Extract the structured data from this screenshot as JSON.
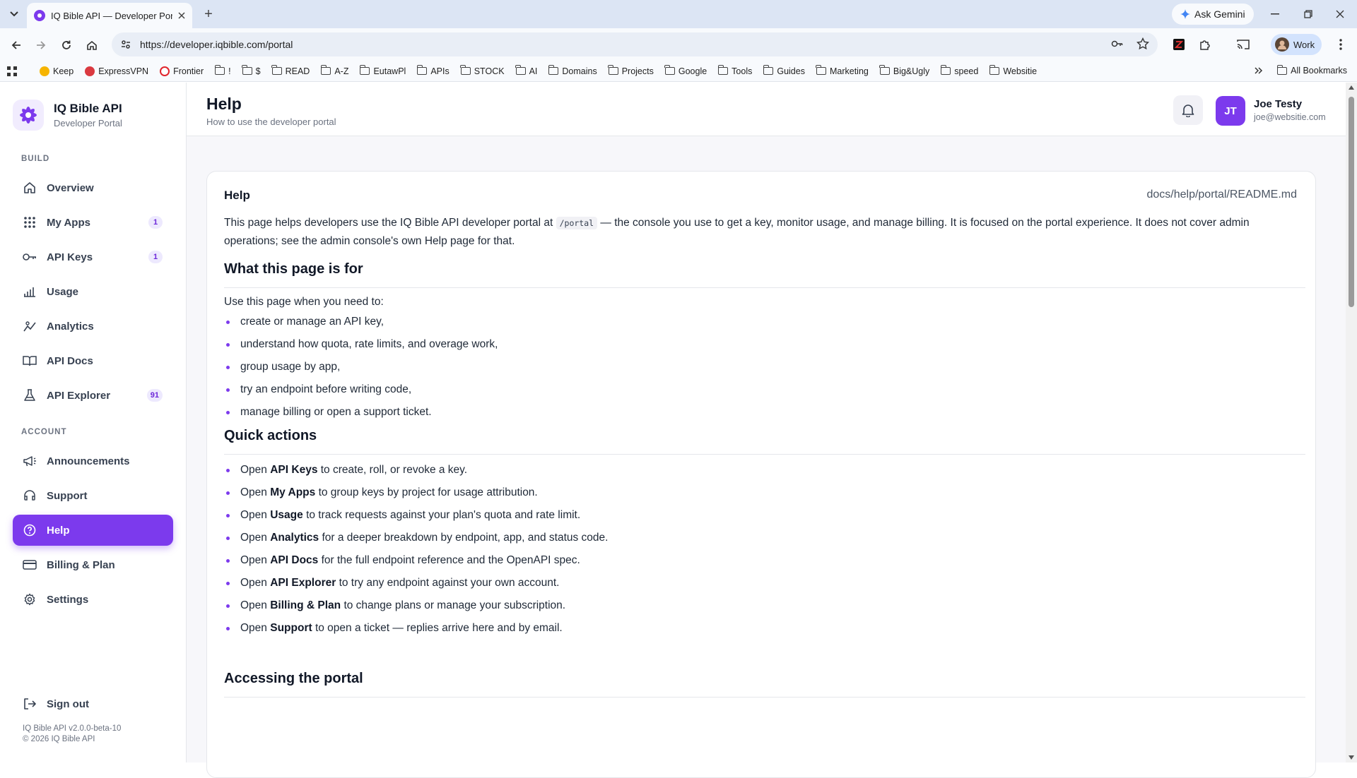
{
  "browser": {
    "tab_title": "IQ Bible API — Developer Porta",
    "ask_gemini": "Ask Gemini",
    "url": "https://developer.iqbible.com/portal",
    "profile_label": "Work",
    "all_bookmarks": "All Bookmarks",
    "bookmarks": [
      {
        "label": "Keep",
        "icon": "keep-icon"
      },
      {
        "label": "ExpressVPN",
        "icon": "expressvpn-icon"
      },
      {
        "label": "Frontier",
        "icon": "frontier-icon"
      },
      {
        "label": "!",
        "icon": "folder-icon"
      },
      {
        "label": "$",
        "icon": "folder-icon"
      },
      {
        "label": "READ",
        "icon": "folder-icon"
      },
      {
        "label": "A-Z",
        "icon": "folder-icon"
      },
      {
        "label": "EutawPl",
        "icon": "folder-icon"
      },
      {
        "label": "APIs",
        "icon": "folder-icon"
      },
      {
        "label": "STOCK",
        "icon": "folder-icon"
      },
      {
        "label": "AI",
        "icon": "folder-icon"
      },
      {
        "label": "Domains",
        "icon": "folder-icon"
      },
      {
        "label": "Projects",
        "icon": "folder-icon"
      },
      {
        "label": "Google",
        "icon": "folder-icon"
      },
      {
        "label": "Tools",
        "icon": "folder-icon"
      },
      {
        "label": "Guides",
        "icon": "folder-icon"
      },
      {
        "label": "Marketing",
        "icon": "folder-icon"
      },
      {
        "label": "Big&Ugly",
        "icon": "folder-icon"
      },
      {
        "label": "speed",
        "icon": "folder-icon"
      },
      {
        "label": "Websitie",
        "icon": "folder-icon"
      }
    ]
  },
  "sidebar": {
    "brand_title": "IQ Bible API",
    "brand_subtitle": "Developer Portal",
    "build_label": "BUILD",
    "account_label": "ACCOUNT",
    "build_items": [
      {
        "label": "Overview",
        "icon": "home-icon",
        "badge": ""
      },
      {
        "label": "My Apps",
        "icon": "grid-icon",
        "badge": "1"
      },
      {
        "label": "API Keys",
        "icon": "key-icon",
        "badge": "1"
      },
      {
        "label": "Usage",
        "icon": "bar-chart-icon",
        "badge": ""
      },
      {
        "label": "Analytics",
        "icon": "trend-icon",
        "badge": ""
      },
      {
        "label": "API Docs",
        "icon": "book-icon",
        "badge": ""
      },
      {
        "label": "API Explorer",
        "icon": "flask-icon",
        "badge": "91"
      }
    ],
    "account_items": [
      {
        "label": "Announcements",
        "icon": "megaphone-icon"
      },
      {
        "label": "Support",
        "icon": "headset-icon"
      },
      {
        "label": "Help",
        "icon": "help-circle-icon"
      },
      {
        "label": "Billing & Plan",
        "icon": "credit-card-icon"
      },
      {
        "label": "Settings",
        "icon": "gear-icon"
      }
    ],
    "active_item": "Help",
    "sign_out": "Sign out",
    "version": "IQ Bible API v2.0.0-beta-10",
    "copyright": "© 2026 IQ Bible API"
  },
  "header": {
    "title": "Help",
    "subtitle": "How to use the developer portal",
    "user_initials": "JT",
    "user_name": "Joe Testy",
    "user_email": "joe@websitie.com"
  },
  "content": {
    "card_title": "Help",
    "doc_path": "docs/help/portal/README.md",
    "intro_before": "This page helps developers use the IQ Bible API developer portal at",
    "intro_code": "/portal",
    "intro_after": "— the console you use to get a key, monitor usage, and manage billing. It is focused on the portal experience. It does not cover admin operations; see the admin console's own Help page for that.",
    "section1_title": "What this page is for",
    "section1_lead": "Use this page when you need to:",
    "section1_items": [
      "create or manage an API key,",
      "understand how quota, rate limits, and overage work,",
      "group usage by app,",
      "try an endpoint before writing code,",
      "manage billing or open a support ticket."
    ],
    "section2_title": "Quick actions",
    "quick_actions": [
      {
        "pre": "Open",
        "bold": "API Keys",
        "post": "to create, roll, or revoke a key."
      },
      {
        "pre": "Open",
        "bold": "My Apps",
        "post": "to group keys by project for usage attribution."
      },
      {
        "pre": "Open",
        "bold": "Usage",
        "post": "to track requests against your plan's quota and rate limit."
      },
      {
        "pre": "Open",
        "bold": "Analytics",
        "post": "for a deeper breakdown by endpoint, app, and status code."
      },
      {
        "pre": "Open",
        "bold": "API Docs",
        "post": "for the full endpoint reference and the OpenAPI spec."
      },
      {
        "pre": "Open",
        "bold": "API Explorer",
        "post": "to try any endpoint against your own account."
      },
      {
        "pre": "Open",
        "bold": "Billing & Plan",
        "post": "to change plans or manage your subscription."
      },
      {
        "pre": "Open",
        "bold": "Support",
        "post": "to open a ticket — replies arrive here and by email."
      }
    ],
    "section3_title": "Accessing the portal"
  },
  "colors": {
    "accent": "#7c3aed",
    "badge_bg": "#ede9fe",
    "tabstrip": "#dce5f4"
  }
}
